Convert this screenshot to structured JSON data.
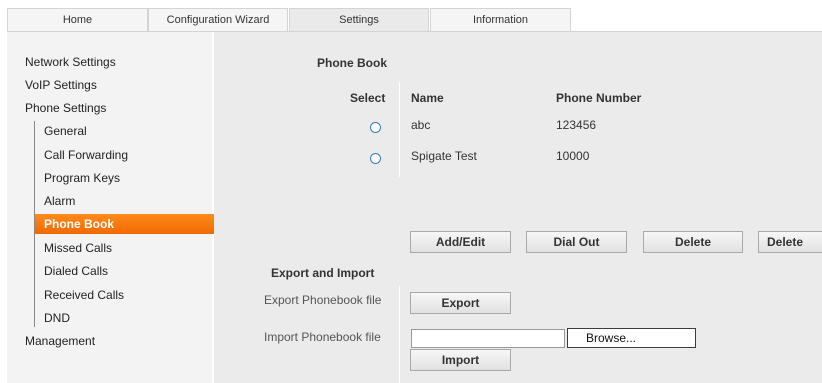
{
  "tabs": [
    "Home",
    "Configuration Wizard",
    "Settings",
    "Information"
  ],
  "sidebar": {
    "network_settings": "Network Settings",
    "voip_settings": "VoIP Settings",
    "phone_settings": "Phone Settings",
    "sub_items": [
      "General",
      "Call Forwarding",
      "Program Keys",
      "Alarm",
      "Phone Book",
      "Missed Calls",
      "Dialed Calls",
      "Received Calls",
      "DND"
    ],
    "management": "Management"
  },
  "phonebook": {
    "section_title": "Phone Book",
    "col_select": "Select",
    "col_name": "Name",
    "col_number": "Phone Number",
    "rows": [
      {
        "name": "abc",
        "number": "123456"
      },
      {
        "name": "Spigate Test",
        "number": "10000"
      }
    ],
    "buttons": {
      "add_edit": "Add/Edit",
      "dial_out": "Dial Out",
      "delete": "Delete",
      "delete_all": "Delete"
    }
  },
  "export_import": {
    "title": "Export and Import",
    "export_label": "Export Phonebook file",
    "export_button": "Export",
    "import_label": "Import Phonebook file",
    "import_value": "",
    "browse_button": "Browse...",
    "import_button": "Import"
  },
  "colors": {
    "accent": "#f57d0f",
    "panel": "#ebebeb",
    "sidebar": "#f3f3f3",
    "radio": "#3a7bc8"
  }
}
